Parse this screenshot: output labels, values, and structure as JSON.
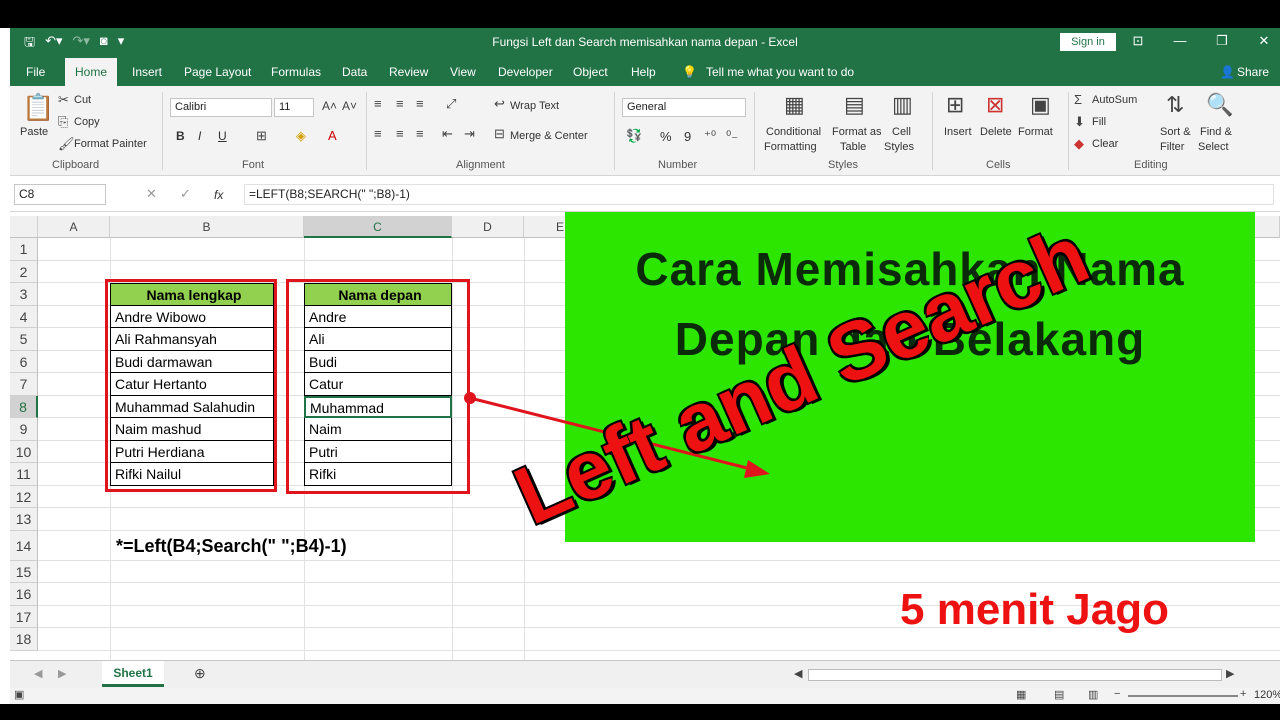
{
  "window": {
    "title": "Fungsi Left dan Search memisahkan nama depan  -  Excel",
    "signin": "Sign in",
    "share": "Share"
  },
  "tabs": [
    "File",
    "Home",
    "Insert",
    "Page Layout",
    "Formulas",
    "Data",
    "Review",
    "View",
    "Developer",
    "Object",
    "Help"
  ],
  "tell_me": "Tell me what you want to do",
  "ribbon": {
    "clipboard": {
      "paste": "Paste",
      "cut": "Cut",
      "copy": "Copy",
      "format_painter": "Format Painter",
      "label": "Clipboard"
    },
    "font": {
      "name": "Calibri",
      "size": "11",
      "bold": "B",
      "italic": "I",
      "underline": "U",
      "label": "Font"
    },
    "alignment": {
      "wrap": "Wrap Text",
      "merge": "Merge & Center",
      "label": "Alignment"
    },
    "number": {
      "format": "General",
      "percent": "%",
      "comma": "9",
      "label": "Number"
    },
    "styles": {
      "conditional": "Conditional",
      "formatting": "Formatting",
      "format_as": "Format as",
      "table": "Table",
      "cell": "Cell",
      "cell_styles": "Styles",
      "label": "Styles"
    },
    "cells": {
      "insert": "Insert",
      "delete": "Delete",
      "format": "Format",
      "label": "Cells"
    },
    "editing": {
      "autosum": "AutoSum",
      "fill": "Fill",
      "clear": "Clear",
      "sort": "Sort &",
      "filter": "Filter",
      "find": "Find &",
      "select": "Select",
      "label": "Editing"
    }
  },
  "formula_bar": {
    "name_box": "C8",
    "fx": "fx",
    "formula": "=LEFT(B8;SEARCH(\" \";B8)-1)"
  },
  "columns": [
    "A",
    "B",
    "C",
    "D",
    "E"
  ],
  "rows": [
    "1",
    "2",
    "3",
    "4",
    "5",
    "6",
    "7",
    "8",
    "9",
    "10",
    "11",
    "12",
    "13",
    "14",
    "15",
    "16",
    "17",
    "18"
  ],
  "table": {
    "header_b": "Nama lengkap",
    "header_c": "Nama depan",
    "full_names": [
      "Andre Wibowo",
      "Ali Rahmansyah",
      "Budi darmawan",
      "Catur Hertanto",
      "Muhammad Salahudin",
      "Naim mashud",
      "Putri Herdiana",
      "Rifki Nailul"
    ],
    "first_names": [
      "Andre",
      "Ali",
      "Budi",
      "Catur",
      "Muhammad",
      "Naim",
      "Putri",
      "Rifki"
    ]
  },
  "note": "*=Left(B4;Search(\" \";B4)-1)",
  "overlay": {
    "title_line1": "Cara Memisahkan Nama",
    "title_line2": "Depan dan Belakang",
    "big_text": "Left and Search",
    "subtitle": "5 menit Jago"
  },
  "sheet_tab": "Sheet1",
  "zoom": "120%",
  "colors": {
    "excel_green": "#217346",
    "header_fill": "#92d050",
    "highlight_red": "#e0141d",
    "overlay_green": "#2ce600"
  }
}
